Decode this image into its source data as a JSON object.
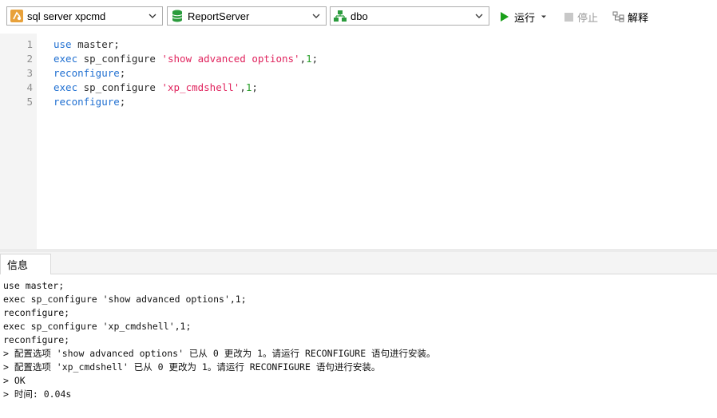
{
  "toolbar": {
    "connection": {
      "label": "sql server xpcmd",
      "icon": "connection-icon"
    },
    "database": {
      "label": "ReportServer",
      "icon": "database-icon"
    },
    "schema": {
      "label": "dbo",
      "icon": "schema-icon"
    },
    "run_label": "运行",
    "stop_label": "停止",
    "explain_label": "解释"
  },
  "editor": {
    "line_numbers": [
      "1",
      "2",
      "3",
      "4",
      "5"
    ],
    "lines": [
      [
        {
          "t": "kw",
          "v": "use"
        },
        {
          "t": "plain",
          "v": " master;"
        }
      ],
      [
        {
          "t": "kw",
          "v": "exec"
        },
        {
          "t": "plain",
          "v": " sp_configure "
        },
        {
          "t": "str",
          "v": "'show advanced options'"
        },
        {
          "t": "plain",
          "v": ","
        },
        {
          "t": "num",
          "v": "1"
        },
        {
          "t": "plain",
          "v": ";"
        }
      ],
      [
        {
          "t": "kw",
          "v": "reconfigure"
        },
        {
          "t": "plain",
          "v": ";"
        }
      ],
      [
        {
          "t": "kw",
          "v": "exec"
        },
        {
          "t": "plain",
          "v": " sp_configure "
        },
        {
          "t": "str",
          "v": "'xp_cmdshell'"
        },
        {
          "t": "plain",
          "v": ","
        },
        {
          "t": "num",
          "v": "1"
        },
        {
          "t": "plain",
          "v": ";"
        }
      ],
      [
        {
          "t": "kw",
          "v": "reconfigure"
        },
        {
          "t": "plain",
          "v": ";"
        }
      ]
    ]
  },
  "output": {
    "tab_label": "信息",
    "messages": [
      "use master;",
      "exec sp_configure 'show advanced options',1;",
      "reconfigure;",
      "exec sp_configure 'xp_cmdshell',1;",
      "reconfigure;",
      "> 配置选项 'show advanced options' 已从 0 更改为 1。请运行 RECONFIGURE 语句进行安装。",
      "> 配置选项 'xp_cmdshell' 已从 0 更改为 1。请运行 RECONFIGURE 语句进行安装。",
      "> OK",
      "> 时间: 0.04s"
    ]
  },
  "colors": {
    "keyword": "#1f6fd1",
    "string": "#e0245e",
    "number": "#2aa02a",
    "run_green": "#1aa01a"
  }
}
